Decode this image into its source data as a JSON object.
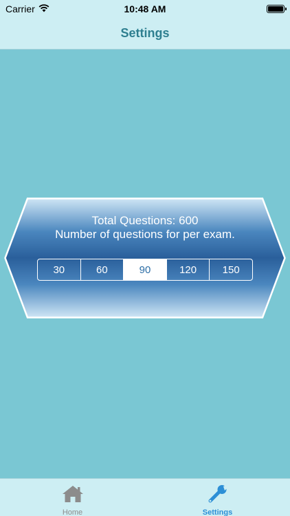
{
  "status_bar": {
    "carrier": "Carrier",
    "time": "10:48 AM"
  },
  "nav": {
    "title": "Settings"
  },
  "card": {
    "total_line": "Total Questions: 600",
    "subtitle": "Number of questions for per exam.",
    "options": [
      "30",
      "60",
      "90",
      "120",
      "150"
    ],
    "selected": "90"
  },
  "tabs": [
    {
      "label": "Home",
      "icon": "home-icon",
      "active": false
    },
    {
      "label": "Settings",
      "icon": "wrench-icon",
      "active": true
    }
  ],
  "colors": {
    "background": "#7ac7d3",
    "bar": "#cdeef3",
    "title": "#2e7f90",
    "card_dark": "#2c5f9a",
    "tab_active": "#2c8fd6"
  }
}
